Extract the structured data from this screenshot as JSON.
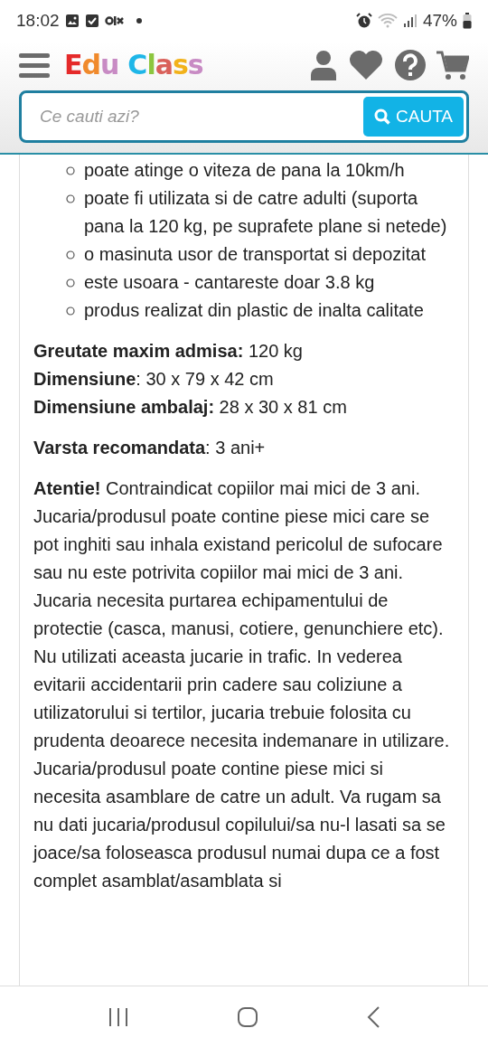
{
  "status_bar": {
    "time": "18:02",
    "battery": "47%"
  },
  "header": {
    "logo": [
      [
        {
          "char": "E",
          "color": "#e52a2a"
        },
        {
          "char": "d",
          "color": "#f08a2c"
        },
        {
          "char": "u",
          "color": "#c88bc4"
        }
      ],
      [
        {
          "char": "C",
          "color": "#1eb6e8"
        },
        {
          "char": "l",
          "color": "#8cc63f"
        },
        {
          "char": "a",
          "color": "#d9605a"
        },
        {
          "char": "s",
          "color": "#f2b21a"
        },
        {
          "char": "s",
          "color": "#c88bc4"
        }
      ]
    ],
    "search": {
      "placeholder": "Ce cauti azi?",
      "button": "CAUTA"
    }
  },
  "features": [
    "poate atinge o viteza de pana la 10km/h",
    "poate fi utilizata si de catre adulti (suporta pana la 120 kg, pe suprafete plane si netede)",
    "o masinuta usor de transportat si depozitat",
    "este usoara - cantareste doar 3.8 kg",
    "produs realizat din plastic de inalta calitate"
  ],
  "specs": [
    "**Greutate maxim admisa:** 120 kg",
    "**Dimensiune**: 30 x 79 x 42 cm",
    "**Dimensiune ambalaj:** 28 x 30 x 81 cm"
  ],
  "age": "**Varsta recomandata**: 3 ani+",
  "warning": "**Atentie!** Contraindicat copiilor mai mici de 3 ani. Jucaria/produsul poate contine piese mici care se pot inghiti sau inhala existand pericolul de sufocare sau nu este potrivita copiilor mai mici de 3 ani. Jucaria necesita purtarea echipamentului de protectie (casca, manusi, cotiere, genunchiere etc). Nu utilizati aceasta jucarie in trafic. In vederea evitarii accidentarii prin cadere sau coliziune a utilizatorului si tertilor, jucaria trebuie folosita cu prudenta deoarece necesita indemanare in utilizare. Jucaria/produsul poate contine piese mici si necesita asamblare de catre un adult. Va rugam sa nu dati jucaria/produsul copilului/sa nu-l lasati sa se joace/sa foloseasca produsul numai dupa ce a fost complet asamblat/asamblata si"
}
